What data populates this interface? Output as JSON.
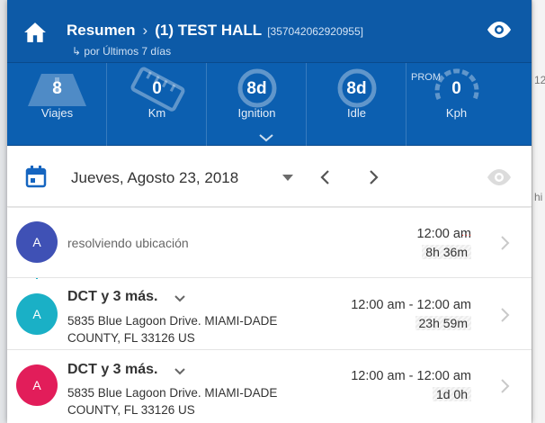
{
  "header": {
    "title": "Resumen",
    "device": "(1) TEST HALL",
    "imei": "[357042062920955]",
    "subtitle": "↳ por Últimos 7 días"
  },
  "stats": [
    {
      "value": "8",
      "label": "Viajes",
      "icon": "road-icon"
    },
    {
      "value": "0",
      "label": "Km",
      "icon": "ruler-icon"
    },
    {
      "value": "8d",
      "label": "Ignition",
      "icon": "ring-icon"
    },
    {
      "value": "8d",
      "label": "Idle",
      "icon": "ring-icon"
    },
    {
      "value": "0",
      "label": "Kph",
      "prefix": "PROM",
      "icon": "gauge-icon"
    }
  ],
  "datebar": {
    "date": "Jueves, Agosto 23, 2018"
  },
  "background": {
    "right_fragment_1": "12",
    "right_fragment_2": "hi"
  },
  "trips": [
    {
      "avatar": "A",
      "avatar_color": "#3f51b5",
      "status": "resolviendo ubicación",
      "time": "12:00 am",
      "duration": "8h 36m",
      "dots": "..."
    },
    {
      "avatar": "A",
      "avatar_color": "#1ab0c6",
      "title": "DCT y 3 más.",
      "address": "5835 Blue Lagoon Drive. MIAMI-DADE COUNTY, FL 33126 US",
      "time": "12:00 am - 12:00 am",
      "duration": "23h 59m"
    },
    {
      "avatar": "A",
      "avatar_color": "#e21d5a",
      "title": "DCT y 3 más.",
      "address": "5835 Blue Lagoon Drive. MIAMI-DADE COUNTY, FL 33126 US",
      "time": "12:00 am - 12:00 am",
      "duration": "1d 0h"
    }
  ],
  "colors": {
    "header_blue": "#0d5aa7",
    "stats_blue": "#0c5fb0",
    "calendar_blue": "#1565c0"
  }
}
